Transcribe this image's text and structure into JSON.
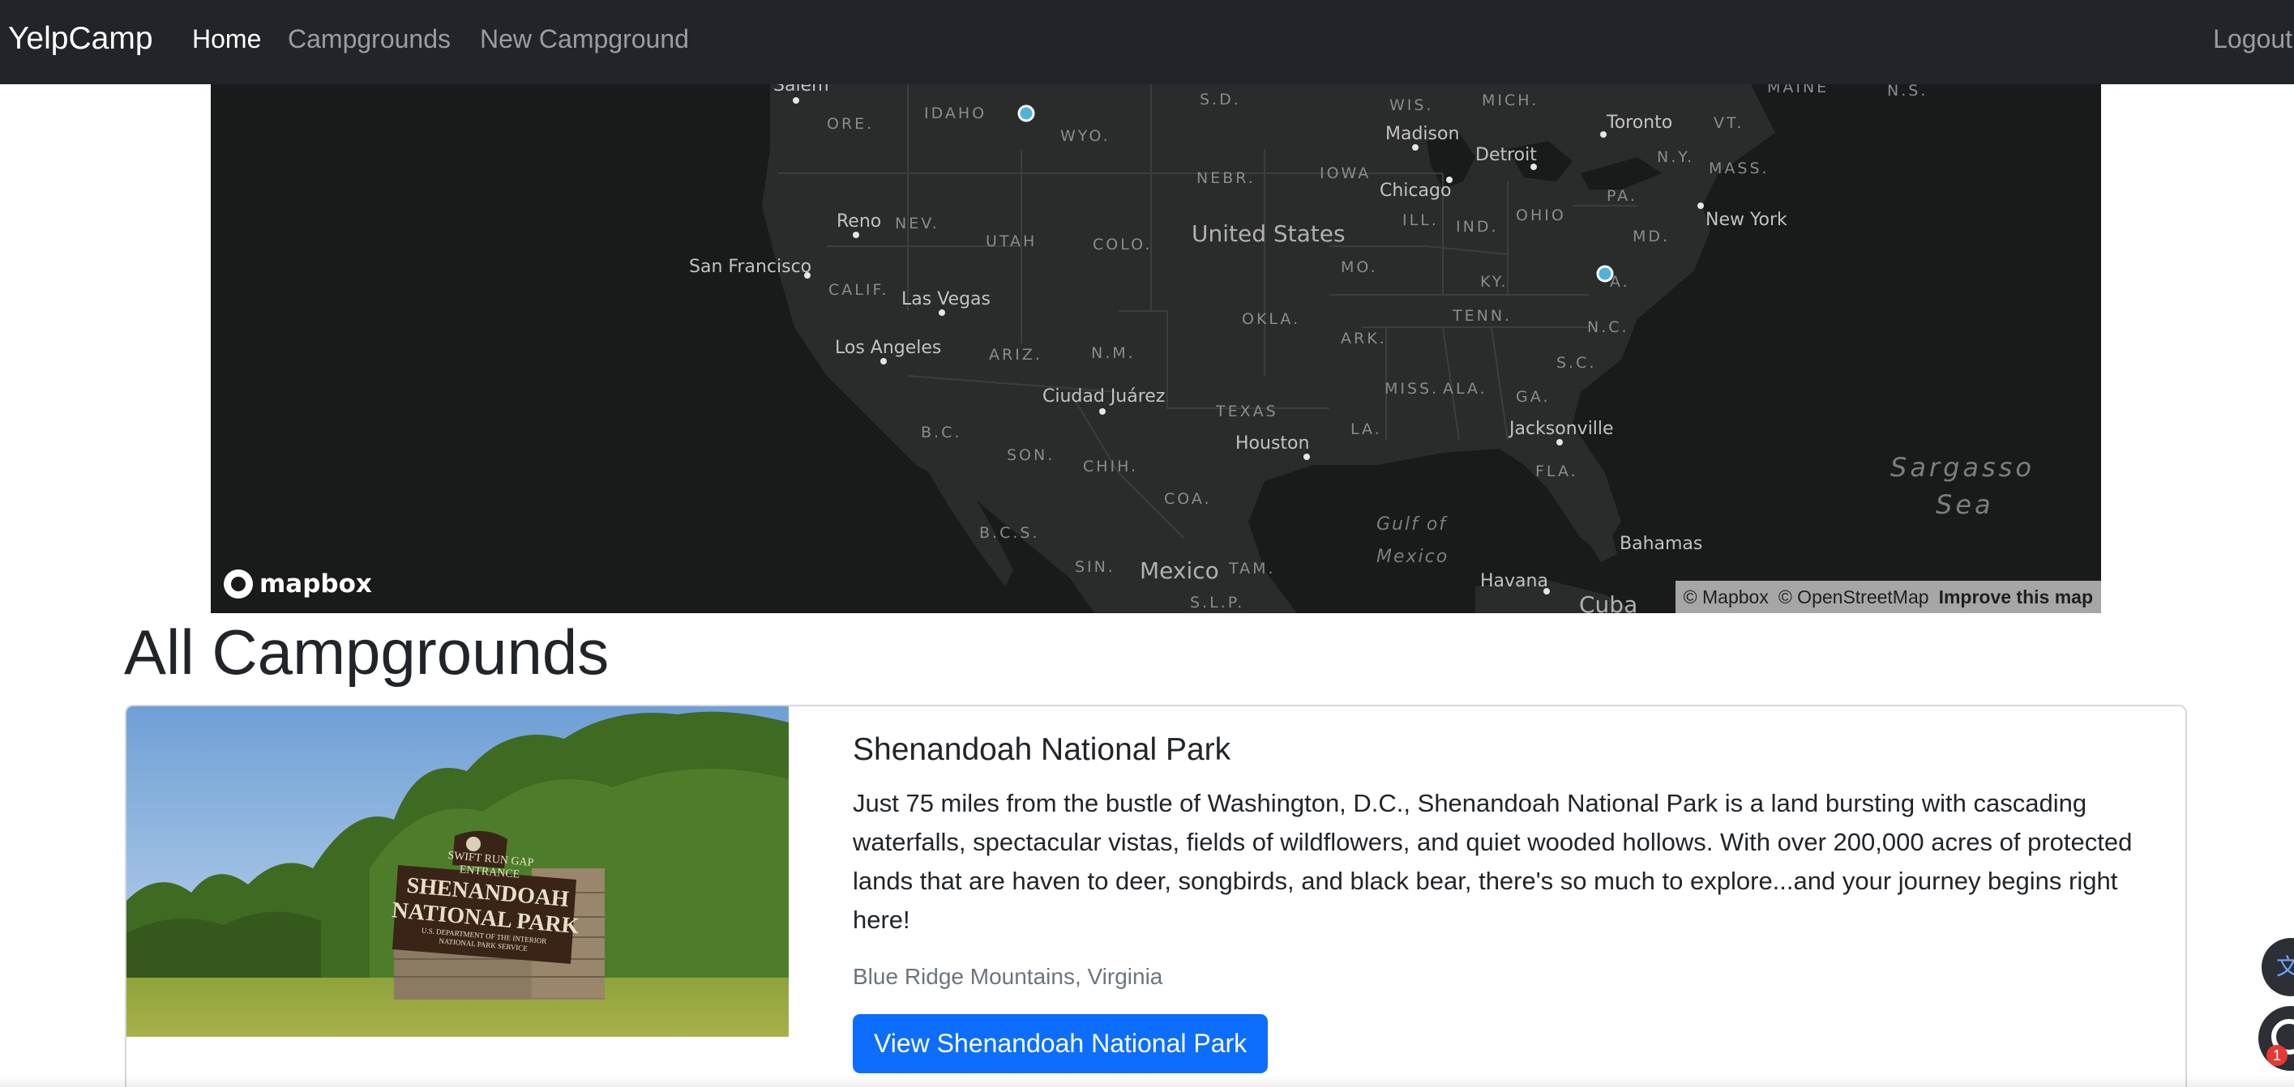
{
  "navbar": {
    "brand": "YelpCamp",
    "links": {
      "home": "Home",
      "campgrounds": "Campgrounds",
      "new_campground": "New Campground"
    },
    "logout": "Logout"
  },
  "map": {
    "labels": {
      "salem": "Salem",
      "idaho": "IDAHO",
      "ore": "ORE.",
      "wyo": "WYO.",
      "sd": "S.D.",
      "wis": "WIS.",
      "mich": "MICH.",
      "maine": "MAINE",
      "ns": "N.S.",
      "toronto": "Toronto",
      "vt": "VT.",
      "madison": "Madison",
      "detroit": "Detroit",
      "ny": "N.Y.",
      "mass": "MASS.",
      "nebr": "NEBR.",
      "iowa": "IOWA",
      "chicago": "Chicago",
      "pa": "PA.",
      "reno": "Reno",
      "nev": "NEV.",
      "utah": "UTAH",
      "colo": "COLO.",
      "united_states": "United States",
      "ill": "ILL.",
      "ind": "IND.",
      "ohio": "OHIO",
      "new_york": "New York",
      "md": "MD.",
      "san_francisco": "San Francisco",
      "mo": "MO.",
      "ky": "KY.",
      "va": "A.",
      "calif": "CALIF.",
      "las_vegas": "Las Vegas",
      "okla": "OKLA.",
      "tenn": "TENN.",
      "nc": "N.C.",
      "los_angeles": "Los Angeles",
      "ariz": "ARIZ.",
      "nm": "N.M.",
      "ark": "ARK.",
      "sc": "S.C.",
      "ciudad_juarez": "Ciudad Juárez",
      "miss": "MISS.",
      "ala": "ALA.",
      "ga": "GA.",
      "texas": "TEXAS",
      "jacksonville": "Jacksonville",
      "bc": "B.C.",
      "la": "LA.",
      "houston": "Houston",
      "son": "SON.",
      "chih": "CHIH.",
      "fla": "FLA.",
      "sargasso": "Sargasso",
      "sea": "Sea",
      "coa": "COA.",
      "gulf_of": "Gulf of",
      "mexico_gulf": "Mexico",
      "bcs": "B.C.S.",
      "bahamas": "Bahamas",
      "sin": "SIN.",
      "mexico": "Mexico",
      "tam": "TAM.",
      "havana": "Havana",
      "slp": "S.L.P.",
      "cuba": "Cuba"
    },
    "logo_text": "mapbox",
    "attribution": {
      "mapbox": "© Mapbox",
      "osm": "© OpenStreetMap",
      "improve": "Improve this map"
    },
    "marker_color": "#4fb3d9"
  },
  "page": {
    "title": "All Campgrounds"
  },
  "campgrounds": [
    {
      "title": "Shenandoah National Park",
      "description": "Just 75 miles from the bustle of Washington, D.C., Shenandoah National Park is a land bursting with cascading waterfalls, spectacular vistas, fields of wildflowers, and quiet wooded hollows. With over 200,000 acres of protected lands that are haven to deer, songbirds, and black bear, there's so much to explore...and your journey begins right here!",
      "location": "Blue Ridge Mountains, Virginia",
      "button": "View Shenandoah National Park",
      "sign": {
        "line1": "SWIFT RUN GAP",
        "line2": "ENTRANCE",
        "line3": "SHENANDOAH",
        "line4": "NATIONAL PARK",
        "line5": "U.S. DEPARTMENT OF THE INTERIOR",
        "line6": "NATIONAL PARK SERVICE"
      }
    }
  ],
  "widgets": {
    "translate_glyph": "文",
    "badge_count": "1"
  },
  "colors": {
    "navbar_bg": "#212529",
    "map_bg": "#191a1a",
    "primary": "#0d6efd"
  }
}
